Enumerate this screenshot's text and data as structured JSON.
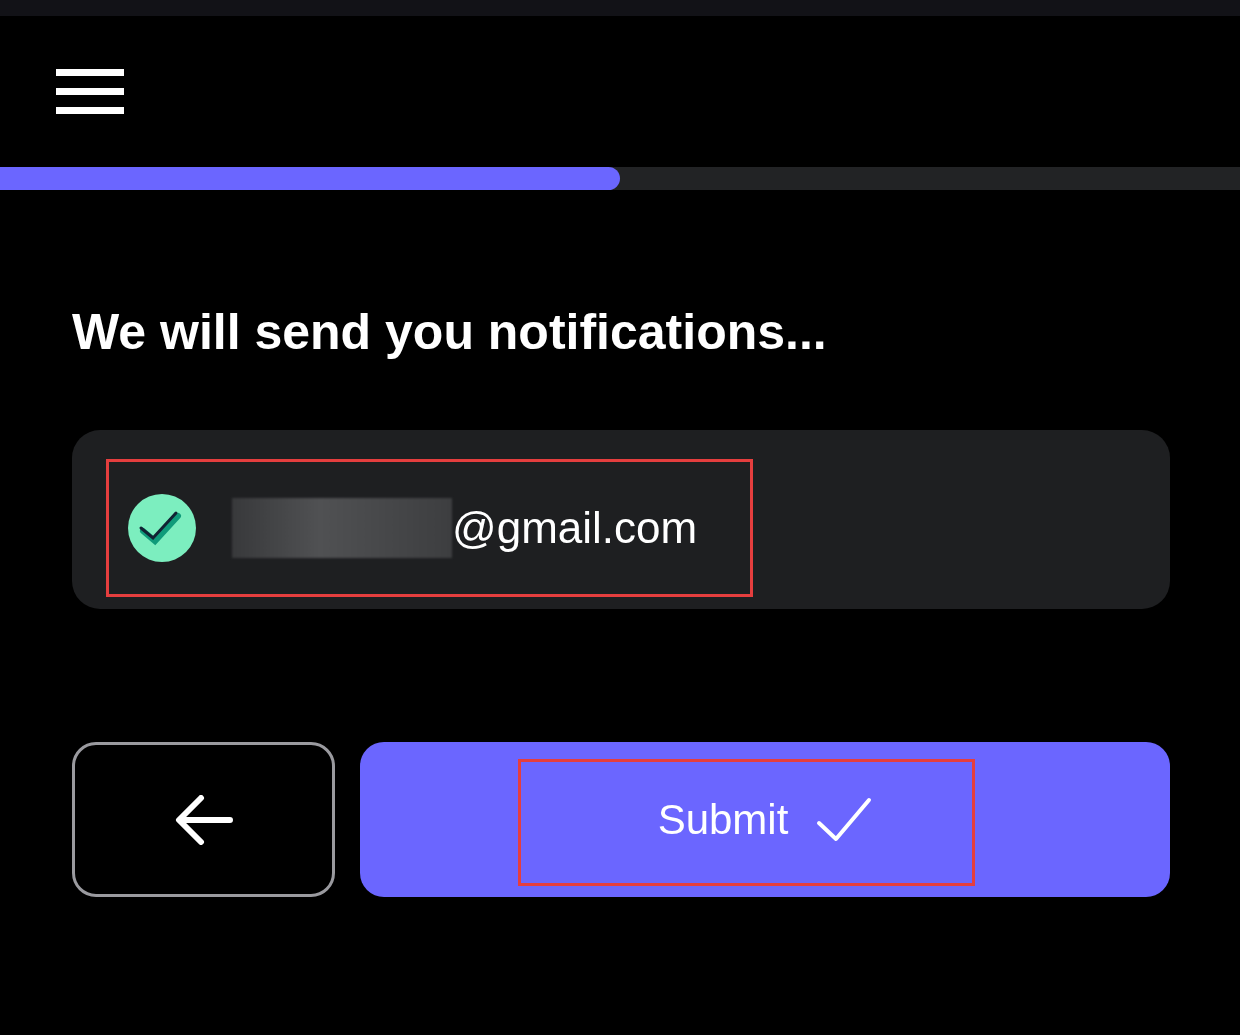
{
  "progress": {
    "level": 0.5
  },
  "heading": "We will send you notifications...",
  "options": [
    {
      "email": "@gmail.com",
      "selected": true,
      "highlighted": true
    }
  ],
  "buttons": {
    "back": {
      "kind": "back"
    },
    "submit": {
      "label": "Submit",
      "highlighted": true
    }
  }
}
